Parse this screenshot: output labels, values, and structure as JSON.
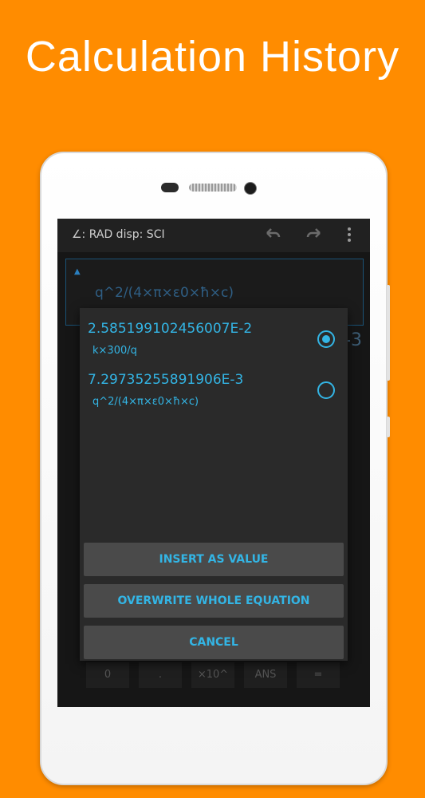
{
  "headline": "Calculation History",
  "topbar": {
    "mode": "∠: RAD  disp: SCI",
    "undo_icon": "undo-icon",
    "redo_icon": "redo-icon",
    "menu_icon": "overflow-menu-icon"
  },
  "equation_field": {
    "text": "q^2/(4×π×ε0×ħ×c)"
  },
  "result_partial": "-3",
  "keypad_row": [
    "0",
    ".",
    "×10^",
    "ANS",
    "="
  ],
  "dialog": {
    "items": [
      {
        "value": "2.585199102456007E-2",
        "expression": "k×300/q",
        "selected": true
      },
      {
        "value": "7.29735255891906E-3",
        "expression": "q^2/(4×π×ε0×ħ×c)",
        "selected": false
      }
    ],
    "buttons": {
      "insert": "INSERT AS VALUE",
      "overwrite": "OVERWRITE WHOLE EQUATION",
      "cancel": "CANCEL"
    }
  },
  "colors": {
    "background": "#FF8C00",
    "accent": "#33b5e5",
    "dialog": "#2a2a2a",
    "button": "#4a4a4a"
  }
}
